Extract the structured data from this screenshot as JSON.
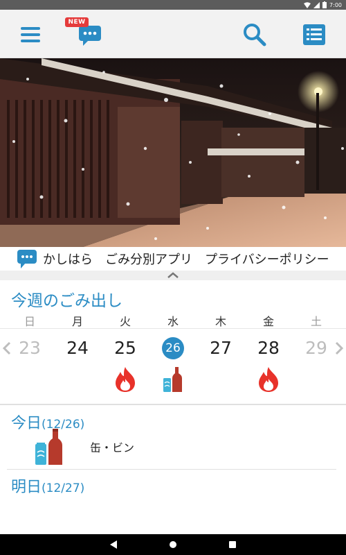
{
  "status_bar": {
    "time": "7:00"
  },
  "appbar": {
    "new_badge": "NEW"
  },
  "ticker": {
    "text": "かしはら　ごみ分別アプリ　プライバシーポリシー"
  },
  "week": {
    "title": "今週のごみ出し",
    "weekdays": [
      "日",
      "月",
      "火",
      "水",
      "木",
      "金",
      "土"
    ],
    "dates": [
      "23",
      "24",
      "25",
      "26",
      "27",
      "28",
      "29"
    ],
    "today_index": 3,
    "icons": [
      "",
      "",
      "flame-icon",
      "can-bottle-icon",
      "",
      "flame-icon",
      ""
    ]
  },
  "today": {
    "label": "今日",
    "date": "(12/26)",
    "item": "缶・ビン"
  },
  "tomorrow": {
    "label": "明日",
    "date": "(12/27)"
  },
  "colors": {
    "accent": "#2b8cc4",
    "badge": "#e53b3b",
    "flame": "#e8322a",
    "bottle": "#b63a2c",
    "can": "#3fb3d8"
  }
}
